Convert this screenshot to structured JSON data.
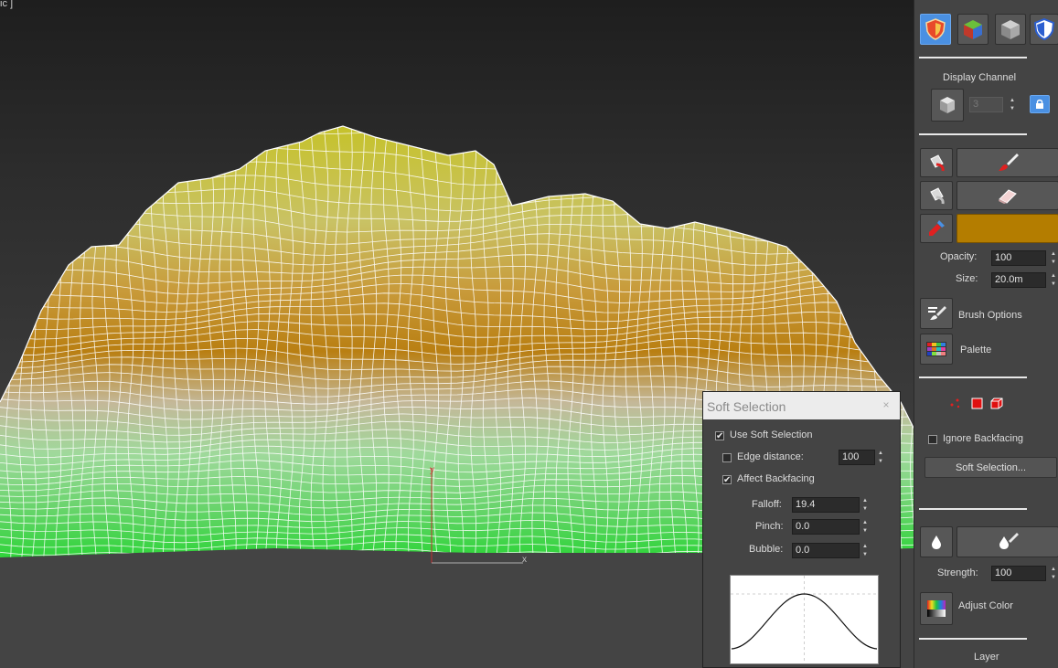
{
  "viewport": {
    "label": "ic ]",
    "axis_x": "x",
    "axis_y": "y"
  },
  "command_panel": {
    "tabs": [
      {
        "icon": "vertex-paint-shield-icon"
      },
      {
        "icon": "color-cube-icon"
      },
      {
        "icon": "gray-cube-icon"
      },
      {
        "icon": "blue-shield-icon"
      }
    ],
    "display_channel": {
      "label": "Display Channel",
      "value": "3",
      "lock_icon": "lock-icon"
    },
    "paint": {
      "brush_icon": "paintbrush-icon",
      "erase_icon": "eraser-icon",
      "picker_icon": "eyedropper-icon",
      "color": "#b47d00"
    },
    "opacity": {
      "label": "Opacity:",
      "value": "100"
    },
    "size": {
      "label": "Size:",
      "value": "20.0m"
    },
    "brush_options_label": "Brush Options",
    "palette_label": "Palette",
    "ignore_backfacing": {
      "label": "Ignore Backfacing",
      "checked": false
    },
    "soft_selection_button": "Soft Selection...",
    "strength": {
      "label": "Strength:",
      "value": "100"
    },
    "adjust_color_label": "Adjust Color",
    "layer_label": "Layer"
  },
  "soft_selection_dialog": {
    "title": "Soft Selection",
    "close": "×",
    "use_soft_selection": {
      "label": "Use Soft Selection",
      "checked": true
    },
    "edge_distance": {
      "label": "Edge distance:",
      "checked": false,
      "value": "100"
    },
    "affect_backfacing": {
      "label": "Affect Backfacing",
      "checked": true
    },
    "falloff": {
      "label": "Falloff:",
      "value": "19.4"
    },
    "pinch": {
      "label": "Pinch:",
      "value": "0.0"
    },
    "bubble": {
      "label": "Bubble:",
      "value": "0.0"
    }
  },
  "colors": {
    "terrain_top": "#c6c22c",
    "terrain_mid": "#b97f12",
    "terrain_low": "#8fd88a",
    "terrain_base": "#2fd43a",
    "paint_swatch": "#b47d00",
    "selection_highlight": "#4a90e2"
  }
}
